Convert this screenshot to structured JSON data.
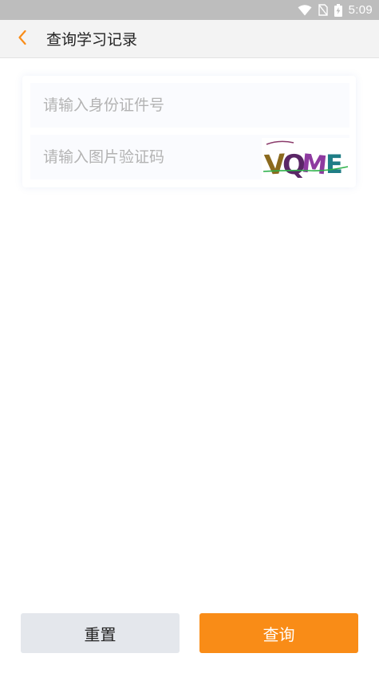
{
  "status_bar": {
    "time": "5:09",
    "icons": [
      "wifi-icon",
      "no-sim-icon",
      "battery-charging-icon"
    ]
  },
  "header": {
    "title": "查询学习记录",
    "back_icon": "chevron-left-icon"
  },
  "form": {
    "id_number_placeholder": "请输入身份证件号",
    "id_number_value": "",
    "captcha_placeholder": "请输入图片验证码",
    "captcha_value": "",
    "captcha_image_text": "VQME"
  },
  "actions": {
    "reset_label": "重置",
    "query_label": "查询"
  },
  "colors": {
    "accent": "#f98c17",
    "status_bar": "#bdbdbd",
    "header_bg": "#f3f3f3",
    "reset_button_bg": "#e4e7ec",
    "placeholder": "#b3b3b3"
  }
}
